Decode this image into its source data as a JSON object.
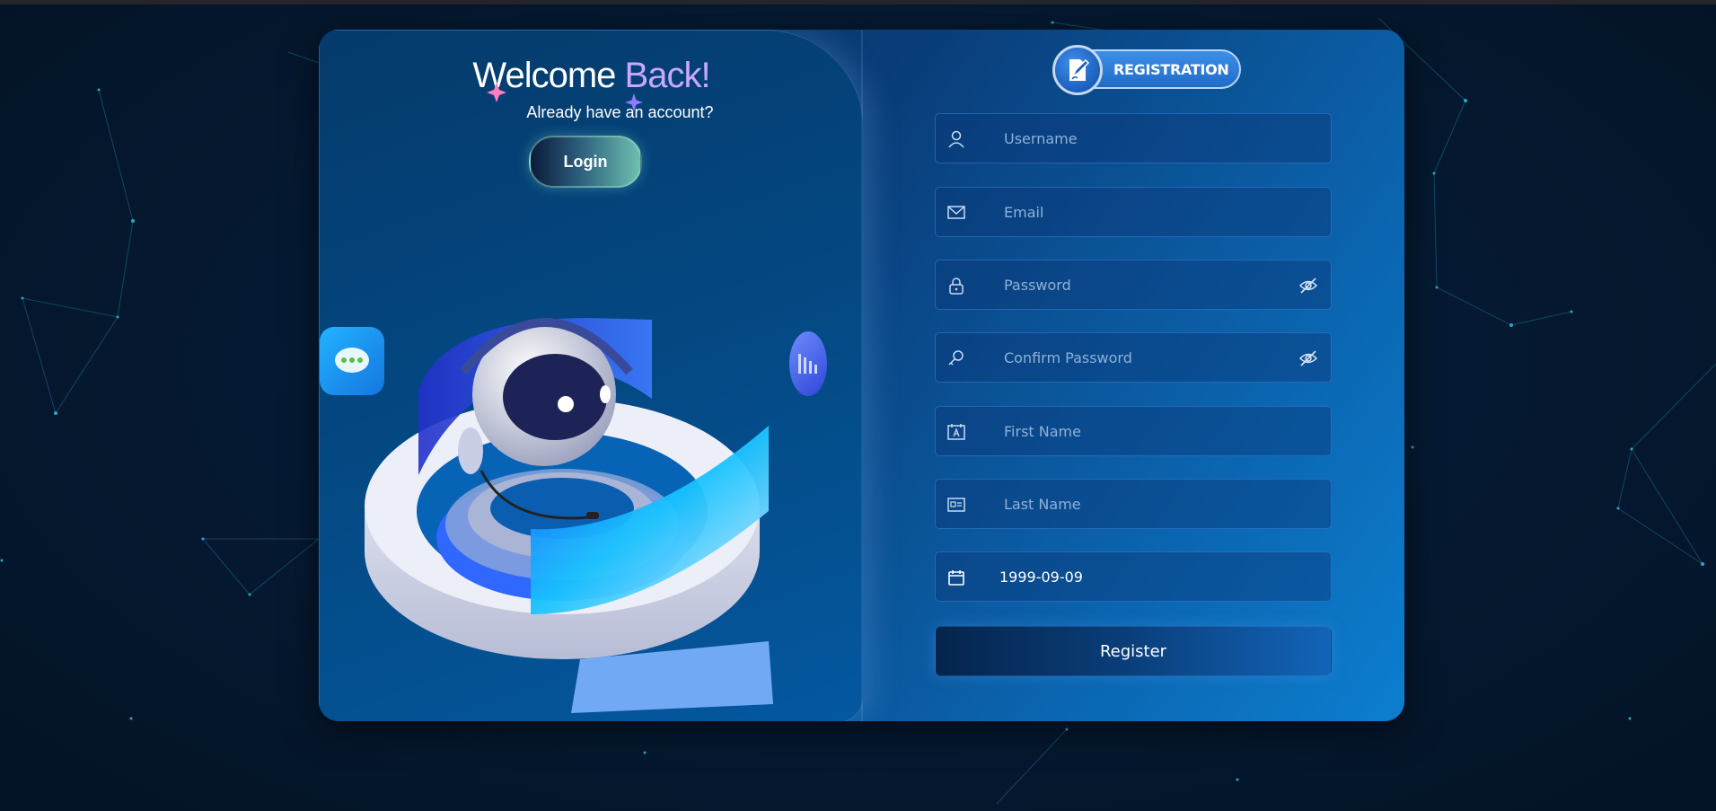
{
  "left_panel": {
    "welcome_part1": "Welcome",
    "welcome_part2": "Back!",
    "subtitle": "Already have an account?",
    "login_label": "Login"
  },
  "badge": {
    "label": "REGISTRATION",
    "icon": "edit-document-icon"
  },
  "form": {
    "fields": [
      {
        "placeholder": "Username",
        "icon": "user-icon"
      },
      {
        "placeholder": "Email",
        "icon": "mail-icon"
      },
      {
        "placeholder": "Password",
        "icon": "lock-icon",
        "toggle": "eye-off-icon"
      },
      {
        "placeholder": "Confirm Password",
        "icon": "key-icon",
        "toggle": "eye-off-icon"
      },
      {
        "placeholder": "First Name",
        "icon": "name-card-icon"
      },
      {
        "placeholder": "Last Name",
        "icon": "id-card-icon"
      },
      {
        "value": "1999-09-09",
        "icon": "calendar-icon"
      }
    ],
    "submit_label": "Register"
  },
  "colors": {
    "accent_purple": "#c7a8ff",
    "field_border": "#3c82dc",
    "page_background": "#051a33"
  }
}
